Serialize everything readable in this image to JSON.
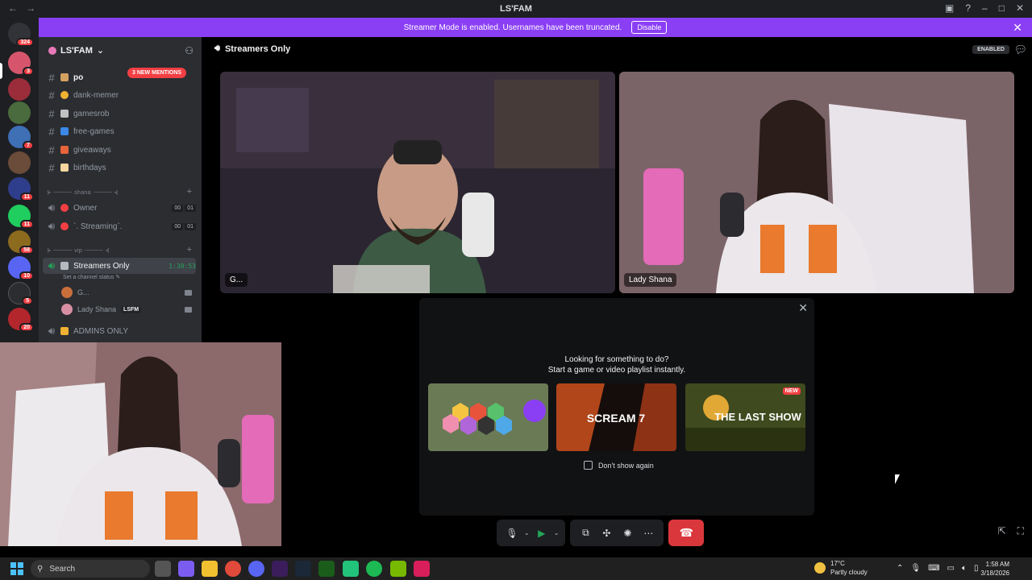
{
  "window": {
    "title": "LS'FAM"
  },
  "banner": {
    "text": "Streamer Mode is enabled. Usernames have been truncated.",
    "button": "Disable"
  },
  "rail": {
    "badges": [
      "324",
      "3",
      "7",
      "11",
      "11",
      "58",
      "10",
      "5",
      "20"
    ]
  },
  "server": {
    "name": "LS'FAM"
  },
  "channels": {
    "mentions_badge": "3 NEW MENTIONS",
    "text": [
      {
        "prefix": "po",
        "label": ""
      },
      {
        "label": "dank-memer"
      },
      {
        "label": "gamesrob"
      },
      {
        "label": "free-games"
      },
      {
        "label": "giveaways"
      },
      {
        "label": "birthdays"
      }
    ],
    "category1": "⊱ ────‧ shana ‧──── ⊰",
    "voice1": [
      {
        "label": "Owner",
        "count_a": "00",
        "count_b": "01"
      },
      {
        "label": "`. Streaming`.",
        "count_a": "00",
        "count_b": "01"
      }
    ],
    "category2": "⊱ ────‧ vip ‧──── ⊰",
    "active_voice": {
      "label": "Streamers Only",
      "timer": "1:30:53",
      "status": "Set a channel status"
    },
    "voice_users": [
      {
        "name": "G..."
      },
      {
        "name": "Lady Shana",
        "tag": "LSFM"
      }
    ],
    "admins": "ADMINS ONLY"
  },
  "stage": {
    "channel": "Streamers Only",
    "enabled_badge": "ENABLED",
    "tiles": [
      {
        "label": "G..."
      },
      {
        "label": "Lady Shana"
      }
    ]
  },
  "popup": {
    "line1": "Looking for something to do?",
    "line2": "Start a game or video playlist instantly.",
    "cards": [
      {
        "title": "HEX PUZZLE",
        "badge": ""
      },
      {
        "title": "SCREAM 7",
        "badge": ""
      },
      {
        "title": "THE LAST SHOW",
        "badge": "NEW"
      }
    ],
    "dont_show": "Don't show again"
  },
  "taskbar": {
    "search": "Search",
    "weather_temp": "17°C",
    "weather_desc": "Partly cloudy",
    "time": "1:58 AM",
    "date": "3/18/2026"
  },
  "colors": {
    "accent": "#8a3ff5",
    "hangup": "#da373c",
    "live": "#23a55a",
    "alert": "#f23f43"
  }
}
